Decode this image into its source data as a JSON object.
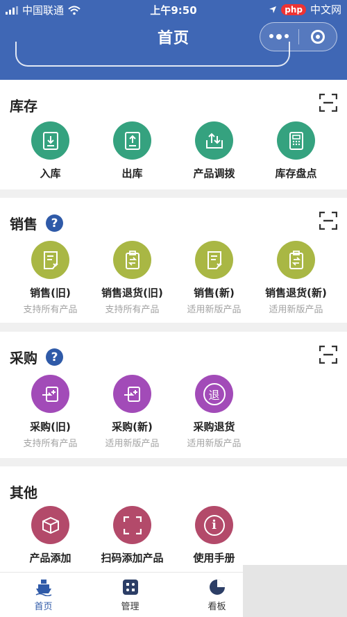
{
  "status_bar": {
    "carrier": "中国联通",
    "time": "上午9:50",
    "badge_php": "php",
    "badge_cn": "中文网"
  },
  "nav": {
    "title": "首页"
  },
  "sections": {
    "inventory": {
      "title": "库存",
      "items": [
        {
          "label": "入库",
          "icon": "stock-in-icon"
        },
        {
          "label": "出库",
          "icon": "stock-out-icon"
        },
        {
          "label": "产品调拨",
          "icon": "transfer-icon"
        },
        {
          "label": "库存盘点",
          "icon": "stocktake-icon"
        }
      ]
    },
    "sales": {
      "title": "销售",
      "items": [
        {
          "label": "销售(旧)",
          "sub": "支持所有产品"
        },
        {
          "label": "销售退货(旧)",
          "sub": "支持所有产品"
        },
        {
          "label": "销售(新)",
          "sub": "适用新版产品"
        },
        {
          "label": "销售退货(新)",
          "sub": "适用新版产品"
        }
      ]
    },
    "purchase": {
      "title": "采购",
      "items": [
        {
          "label": "采购(旧)",
          "sub": "支持所有产品"
        },
        {
          "label": "采购(新)",
          "sub": "适用新版产品"
        },
        {
          "label": "采购退货",
          "sub": "适用新版产品",
          "glyph": "退"
        }
      ]
    },
    "other": {
      "title": "其他",
      "items": [
        {
          "label": "产品添加"
        },
        {
          "label": "扫码添加产品"
        },
        {
          "label": "使用手册",
          "glyph": "i"
        }
      ]
    }
  },
  "tabbar": {
    "items": [
      {
        "label": "首页"
      },
      {
        "label": "管理"
      },
      {
        "label": "看板"
      }
    ]
  },
  "colors": {
    "brand": "#3f67b5",
    "inventory": "#35a27f",
    "sales": "#a9b744",
    "purchase": "#a24bb8",
    "other": "#b34a6a"
  }
}
